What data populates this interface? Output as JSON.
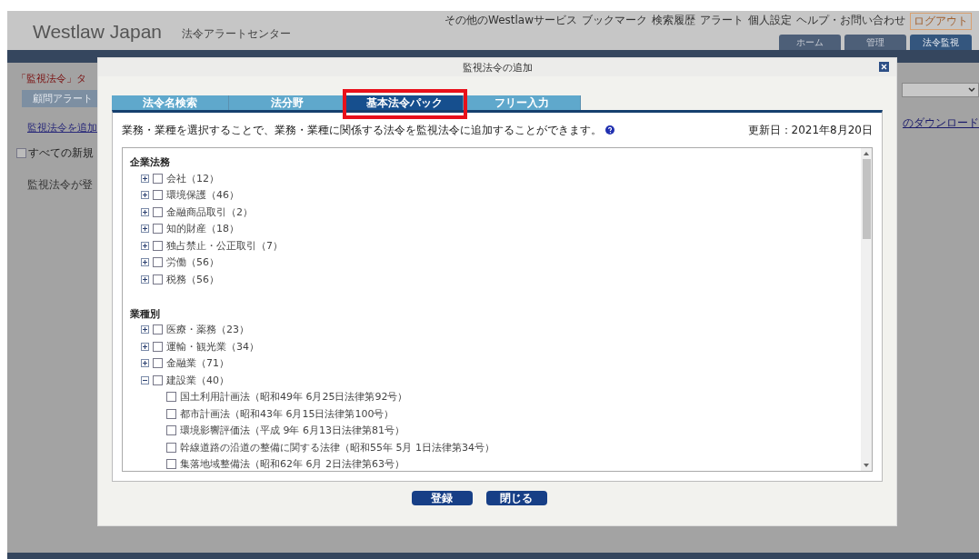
{
  "header": {
    "logo": "Westlaw Japan",
    "subtitle": "法令アラートセンター",
    "utility_links": [
      "その他のWestlawサービス",
      "ブックマーク",
      "検索履歴",
      "アラート",
      "個人設定",
      "ヘルプ・お問い合わせ",
      "ログアウト"
    ],
    "tabs": [
      {
        "label": "ホーム",
        "selected": false
      },
      {
        "label": "管理",
        "selected": false
      },
      {
        "label": "法令監視",
        "selected": true
      }
    ]
  },
  "background": {
    "notice": "「監視法令」タ",
    "section_bar": "顧問アラート",
    "add_link": "監視法令を追加",
    "select_all": {
      "label": "すべての新規",
      "checked": false
    },
    "empty_message": "監視法令が登",
    "download_link": "のダウンロード"
  },
  "dialog": {
    "title": "監視法令の追加",
    "tabs": [
      {
        "label": "法令名検索",
        "selected": false,
        "highlighted": false
      },
      {
        "label": "法分野",
        "selected": false,
        "highlighted": false
      },
      {
        "label": "基本法令パック",
        "selected": true,
        "highlighted": true
      },
      {
        "label": "フリー入力",
        "selected": false,
        "highlighted": false
      }
    ],
    "description": "業務・業種を選択することで、業務・業種に関係する法令を監視法令に追加することができます。",
    "updated": "更新日：2021年8月20日",
    "sections": [
      {
        "title": "企業法務",
        "items": [
          {
            "label": "会社（12）",
            "expanded": false,
            "checked": false
          },
          {
            "label": "環境保護（46）",
            "expanded": false,
            "checked": false
          },
          {
            "label": "金融商品取引（2）",
            "expanded": false,
            "checked": false
          },
          {
            "label": "知的財産（18）",
            "expanded": false,
            "checked": false
          },
          {
            "label": "独占禁止・公正取引（7）",
            "expanded": false,
            "checked": false
          },
          {
            "label": "労働（56）",
            "expanded": false,
            "checked": false
          },
          {
            "label": "税務（56）",
            "expanded": false,
            "checked": false
          }
        ]
      },
      {
        "title": "業種別",
        "items": [
          {
            "label": "医療・薬務（23）",
            "expanded": false,
            "checked": false
          },
          {
            "label": "運輸・観光業（34）",
            "expanded": false,
            "checked": false
          },
          {
            "label": "金融業（71）",
            "expanded": false,
            "checked": false
          },
          {
            "label": "建設業（40）",
            "expanded": true,
            "checked": false,
            "children": [
              {
                "label": "国土利用計画法（昭和49年 6月25日法律第92号）",
                "checked": false
              },
              {
                "label": "都市計画法（昭和43年 6月15日法律第100号）",
                "checked": false
              },
              {
                "label": "環境影響評価法（平成 9年 6月13日法律第81号）",
                "checked": false
              },
              {
                "label": "幹線道路の沿道の整備に関する法律（昭和55年 5月 1日法律第34号）",
                "checked": false
              },
              {
                "label": "集落地域整備法（昭和62年 6月 2日法律第63号）",
                "checked": false
              }
            ]
          }
        ]
      }
    ],
    "buttons": [
      "登録",
      "閉じる"
    ]
  }
}
